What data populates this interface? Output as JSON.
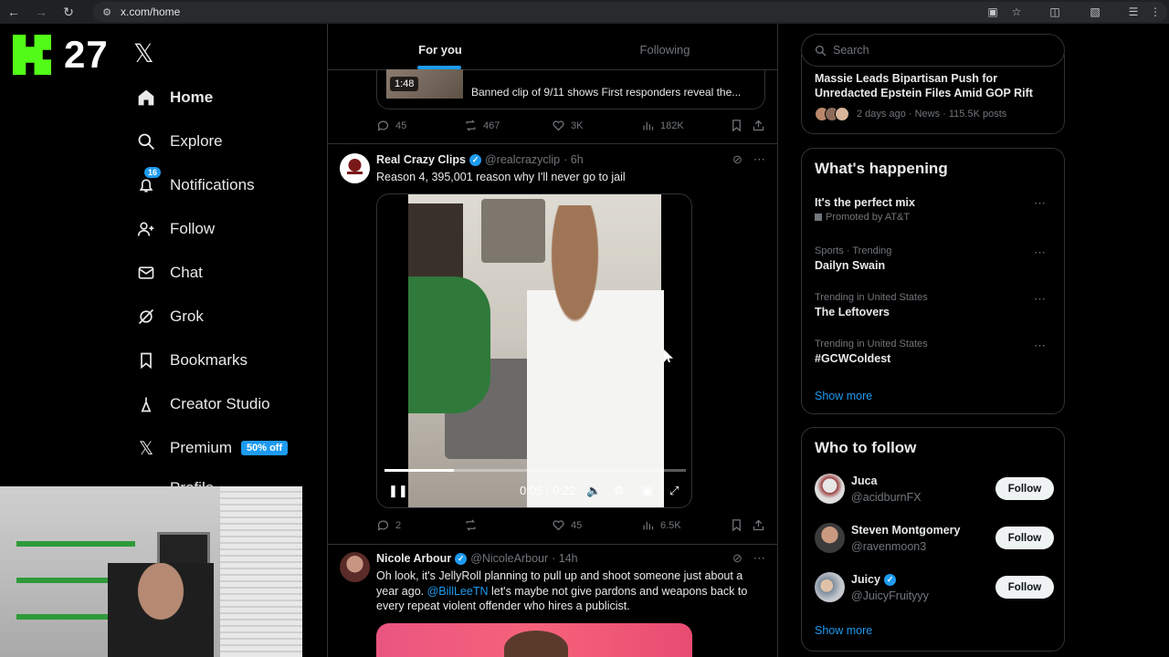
{
  "browser": {
    "url": "x.com/home",
    "icons": [
      "back-icon",
      "forward-icon",
      "reload-icon",
      "site-info-icon",
      "install-icon",
      "star-icon",
      "extensions-icon",
      "cast-icon",
      "media-controls-icon"
    ]
  },
  "overlay": {
    "kick_count": "27"
  },
  "nav": {
    "items": [
      {
        "label": "Home"
      },
      {
        "label": "Explore"
      },
      {
        "label": "Notifications",
        "badge": "16"
      },
      {
        "label": "Follow"
      },
      {
        "label": "Chat"
      },
      {
        "label": "Grok"
      },
      {
        "label": "Bookmarks"
      },
      {
        "label": "Creator Studio"
      },
      {
        "label": "Premium",
        "badge": "50% off"
      }
    ],
    "partial_label": "Profile"
  },
  "timeline": {
    "tabs": [
      {
        "label": "For you"
      },
      {
        "label": "Following"
      }
    ],
    "card": {
      "duration": "1:48",
      "title": "Banned clip of 9/11 shows First responders reveal the..."
    },
    "first_actions": {
      "replies": "45",
      "reposts": "467",
      "likes": "3K",
      "views": "182K"
    },
    "tweet1": {
      "name": "Real Crazy Clips",
      "handle": "@realcrazyclip",
      "time": "· 6h",
      "text": "Reason 4, 395,001 reason why I'll never go to jail",
      "video": {
        "time": "0:05 / 0:22",
        "progress": 0.23
      },
      "actions": {
        "replies": "2",
        "reposts": "",
        "likes": "45",
        "views": "6.5K"
      }
    },
    "tweet2": {
      "name": "Nicole Arbour",
      "handle": "@NicoleArbour",
      "time": "· 14h",
      "text_before": "Oh look, it's JellyRoll planning to pull up and shoot someone just about a year ago.",
      "mention": "@BillLeeTN",
      "text_after": "let's maybe not give pardons and weapons back to every repeat violent offender who hires a publicist."
    }
  },
  "sidebar": {
    "search_placeholder": "Search",
    "top_news": {
      "title": "Massie Leads Bipartisan Push for Unredacted Epstein Files Amid GOP Rift",
      "meta": "2 days ago · News · 115.5K posts"
    },
    "happening": {
      "title": "What's happening",
      "trends": [
        {
          "meta": "Promoted by AT&T",
          "name": "It's the perfect mix",
          "promoted": true
        },
        {
          "meta": "Sports · Trending",
          "name": "Dailyn Swain"
        },
        {
          "meta": "Trending in United States",
          "name": "The Leftovers"
        },
        {
          "meta": "Trending in United States",
          "name": "#GCWColdest"
        }
      ],
      "show_more": "Show more"
    },
    "who_to_follow": {
      "title": "Who to follow",
      "users": [
        {
          "name": "Juca",
          "handle": "@acidburnFX",
          "button": "Follow",
          "verified": false
        },
        {
          "name": "Steven Montgomery",
          "handle": "@ravenmoon3",
          "button": "Follow",
          "verified": false
        },
        {
          "name": "Juicy",
          "handle": "@JuicyFruityyy",
          "button": "Follow",
          "verified": true
        }
      ],
      "show_more": "Show more"
    }
  }
}
